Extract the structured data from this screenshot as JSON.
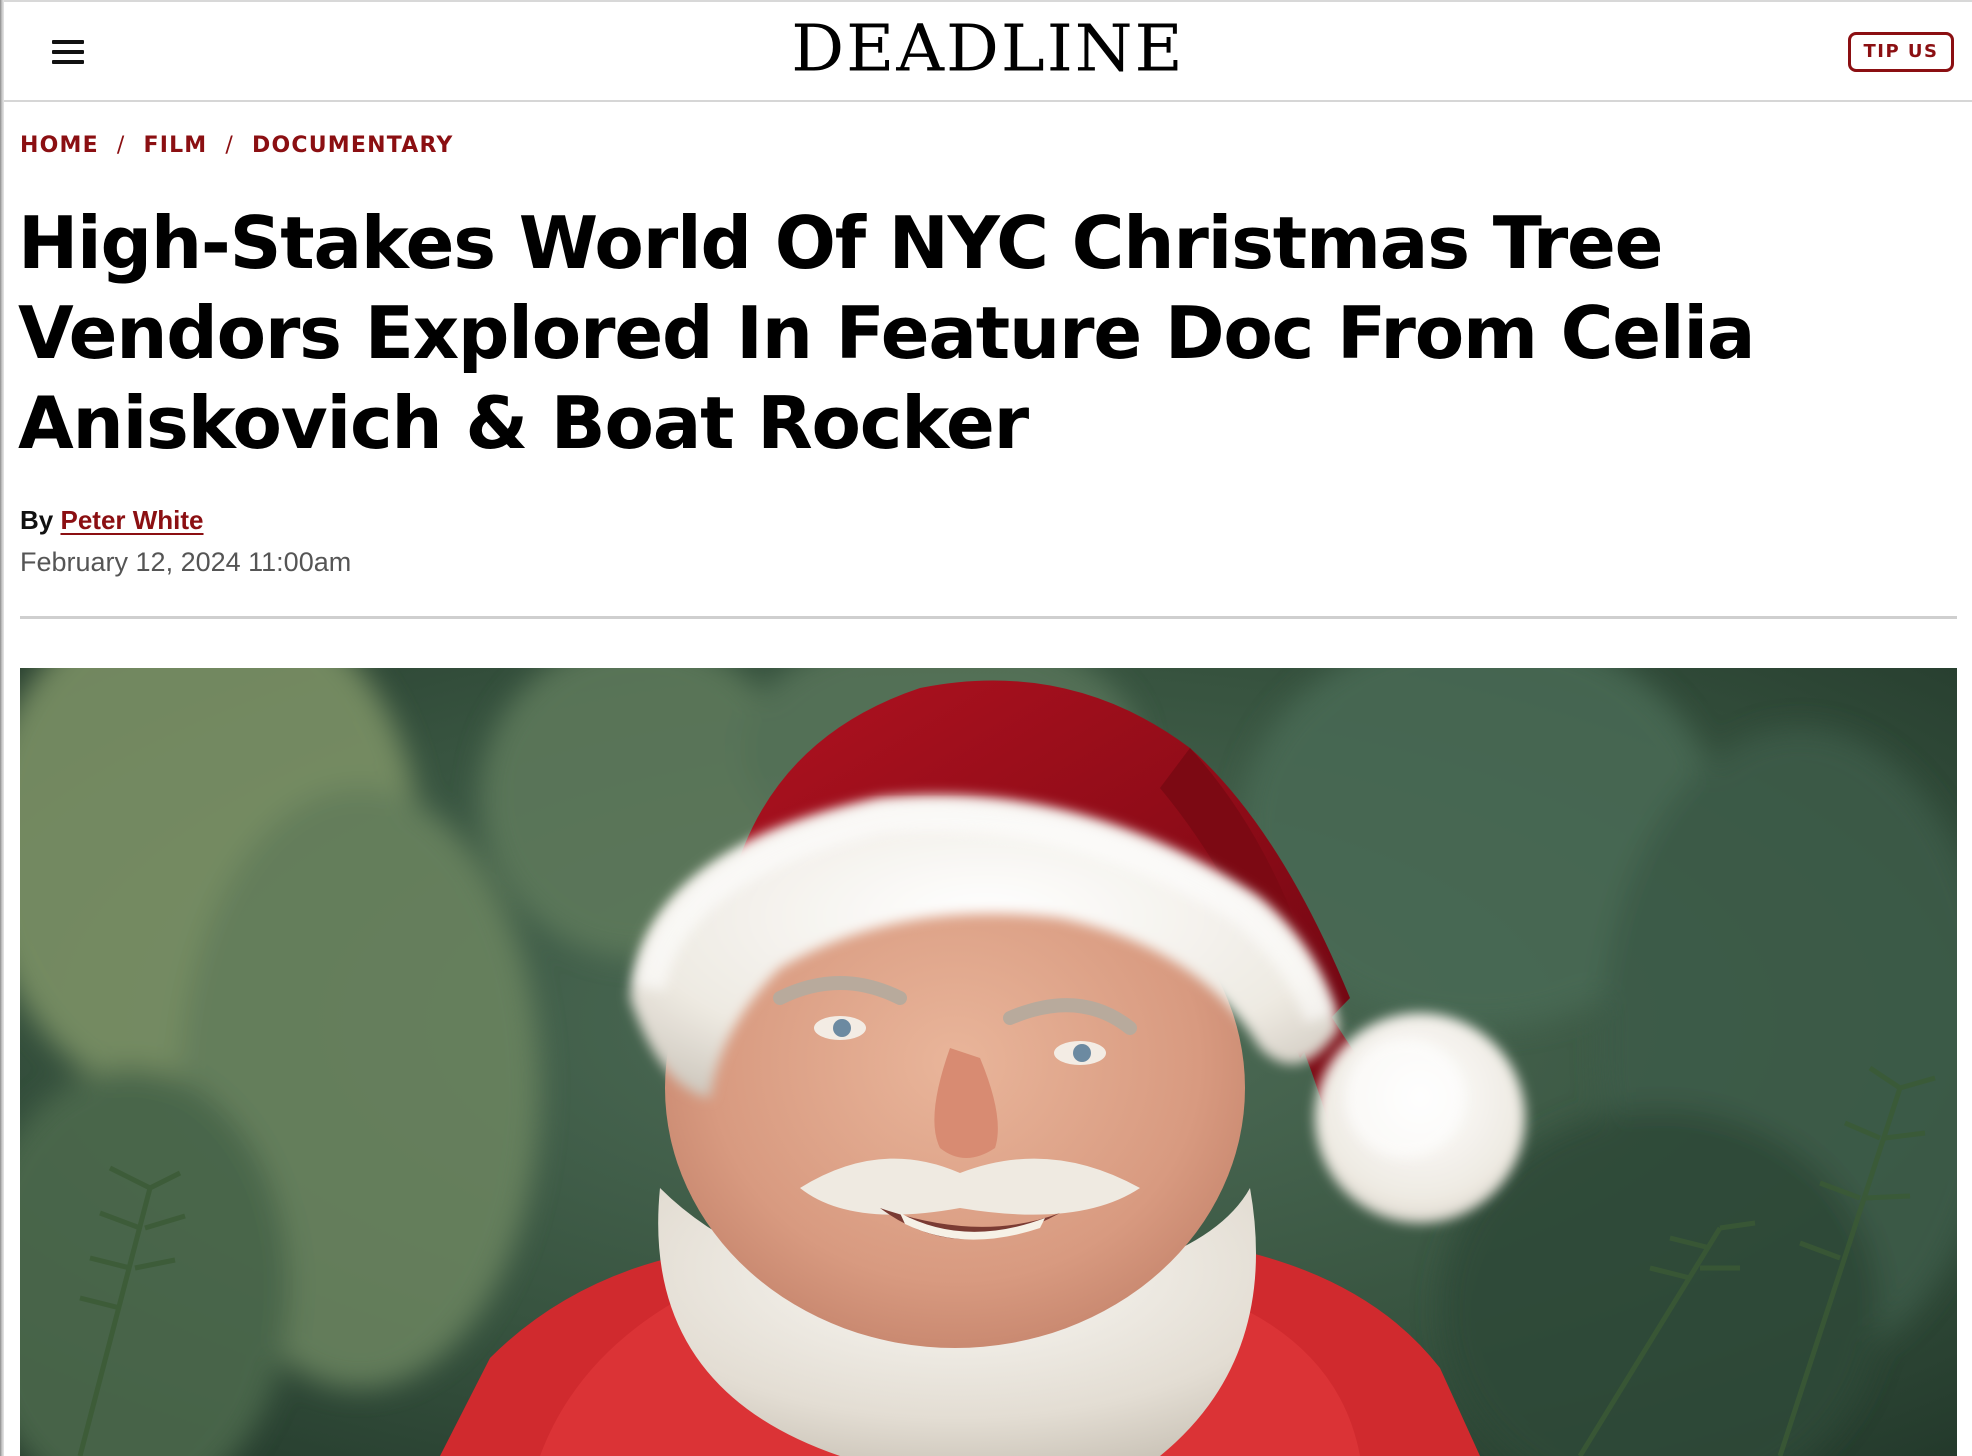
{
  "site": {
    "logo_text": "DEADLINE",
    "tip_button_label": "TIP US",
    "menu_icon": "hamburger-menu-icon"
  },
  "breadcrumb": {
    "items": [
      "HOME",
      "FILM",
      "DOCUMENTARY"
    ],
    "separator": "/"
  },
  "article": {
    "headline": "High-Stakes World Of NYC Christmas Tree Vendors Explored In Feature Doc From Celia Aniskovich & Boat Rocker",
    "byline_prefix": "By",
    "author": "Peter White",
    "date": "February 12, 2024 11:00am"
  },
  "hero_image": {
    "subject": "santa-claus-photo"
  },
  "colors": {
    "accent": "#8b0f12",
    "text": "#000000",
    "muted": "#555555",
    "divider": "#cfcfcf"
  }
}
